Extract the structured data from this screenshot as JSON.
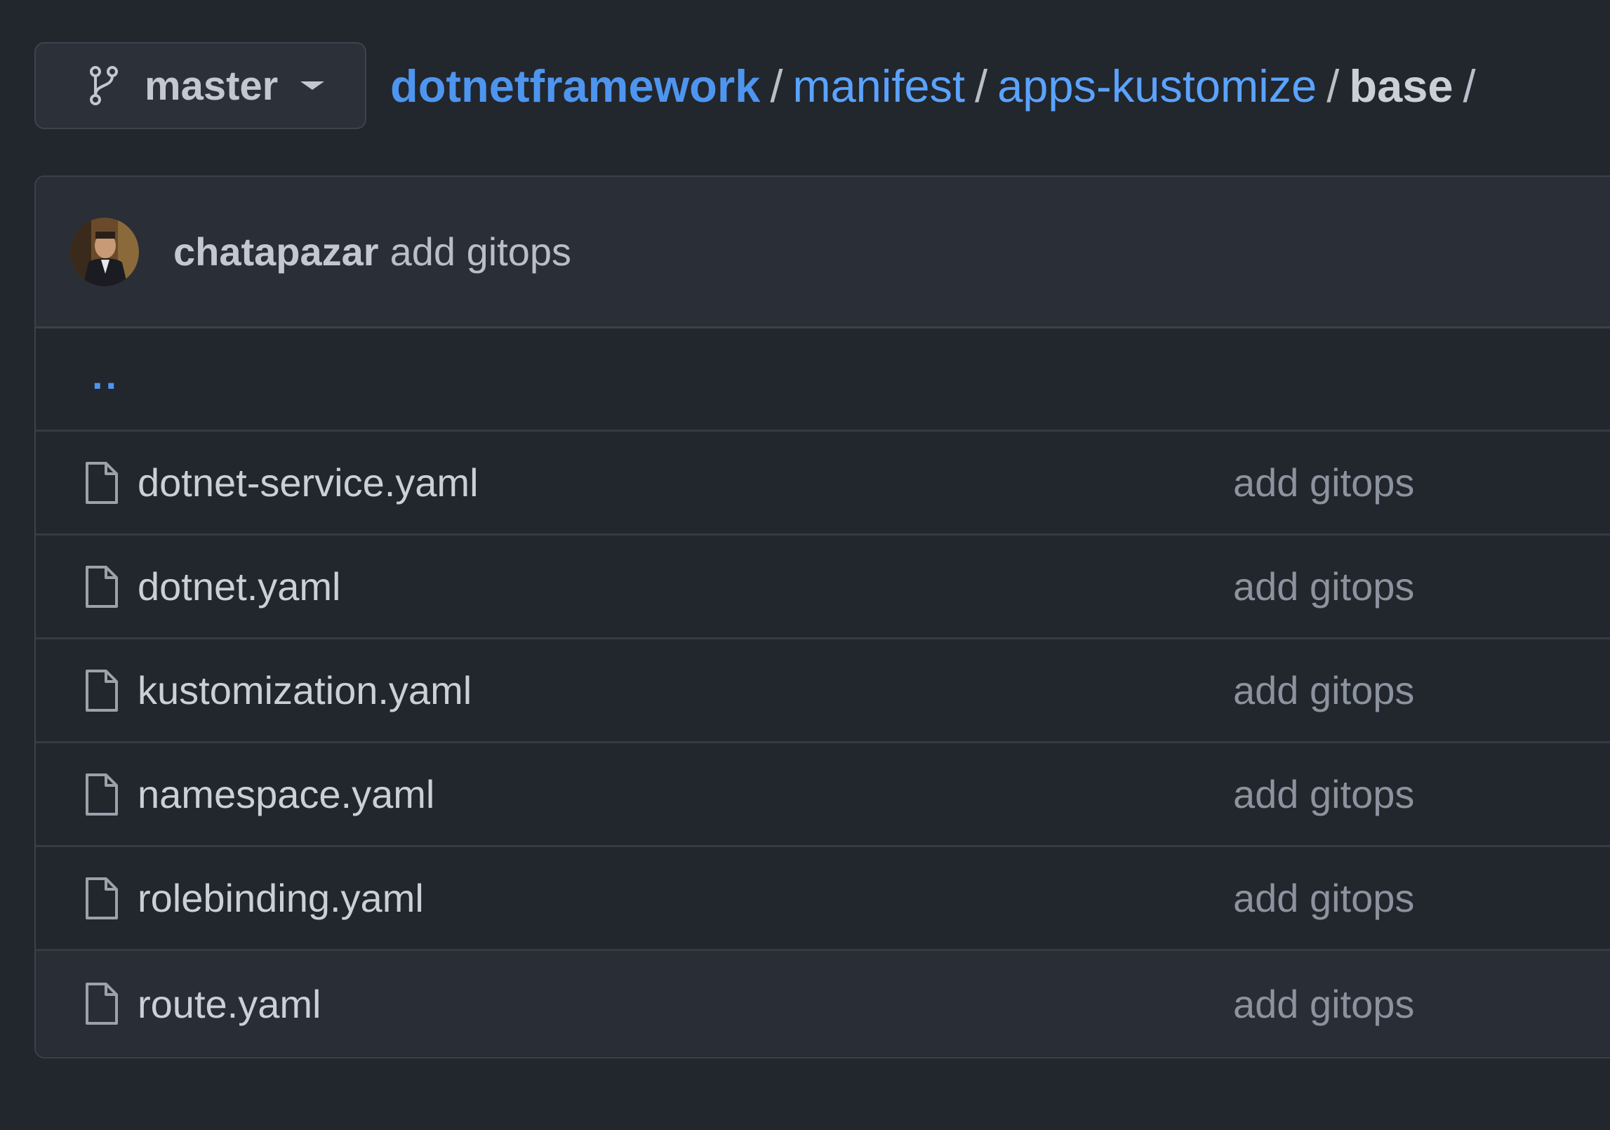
{
  "branch": {
    "name": "master",
    "icon": "git-branch-icon",
    "caret_icon": "caret-down-icon"
  },
  "breadcrumb": {
    "repo": "dotnetframework",
    "segments": [
      "manifest",
      "apps-kustomize"
    ],
    "current": "base",
    "separator": "/"
  },
  "latest_commit": {
    "author": "chatapazar",
    "message": "add gitops"
  },
  "parent_dir": {
    "label": ".."
  },
  "files": [
    {
      "name": "dotnet-service.yaml",
      "commit": "add gitops",
      "icon": "file-icon"
    },
    {
      "name": "dotnet.yaml",
      "commit": "add gitops",
      "icon": "file-icon"
    },
    {
      "name": "kustomization.yaml",
      "commit": "add gitops",
      "icon": "file-icon"
    },
    {
      "name": "namespace.yaml",
      "commit": "add gitops",
      "icon": "file-icon"
    },
    {
      "name": "rolebinding.yaml",
      "commit": "add gitops",
      "icon": "file-icon"
    },
    {
      "name": "route.yaml",
      "commit": "add gitops",
      "icon": "file-icon"
    }
  ],
  "colors": {
    "background": "#22262d",
    "link": "#4e95ef",
    "muted_text": "#8b939e",
    "border": "#3b414a"
  }
}
